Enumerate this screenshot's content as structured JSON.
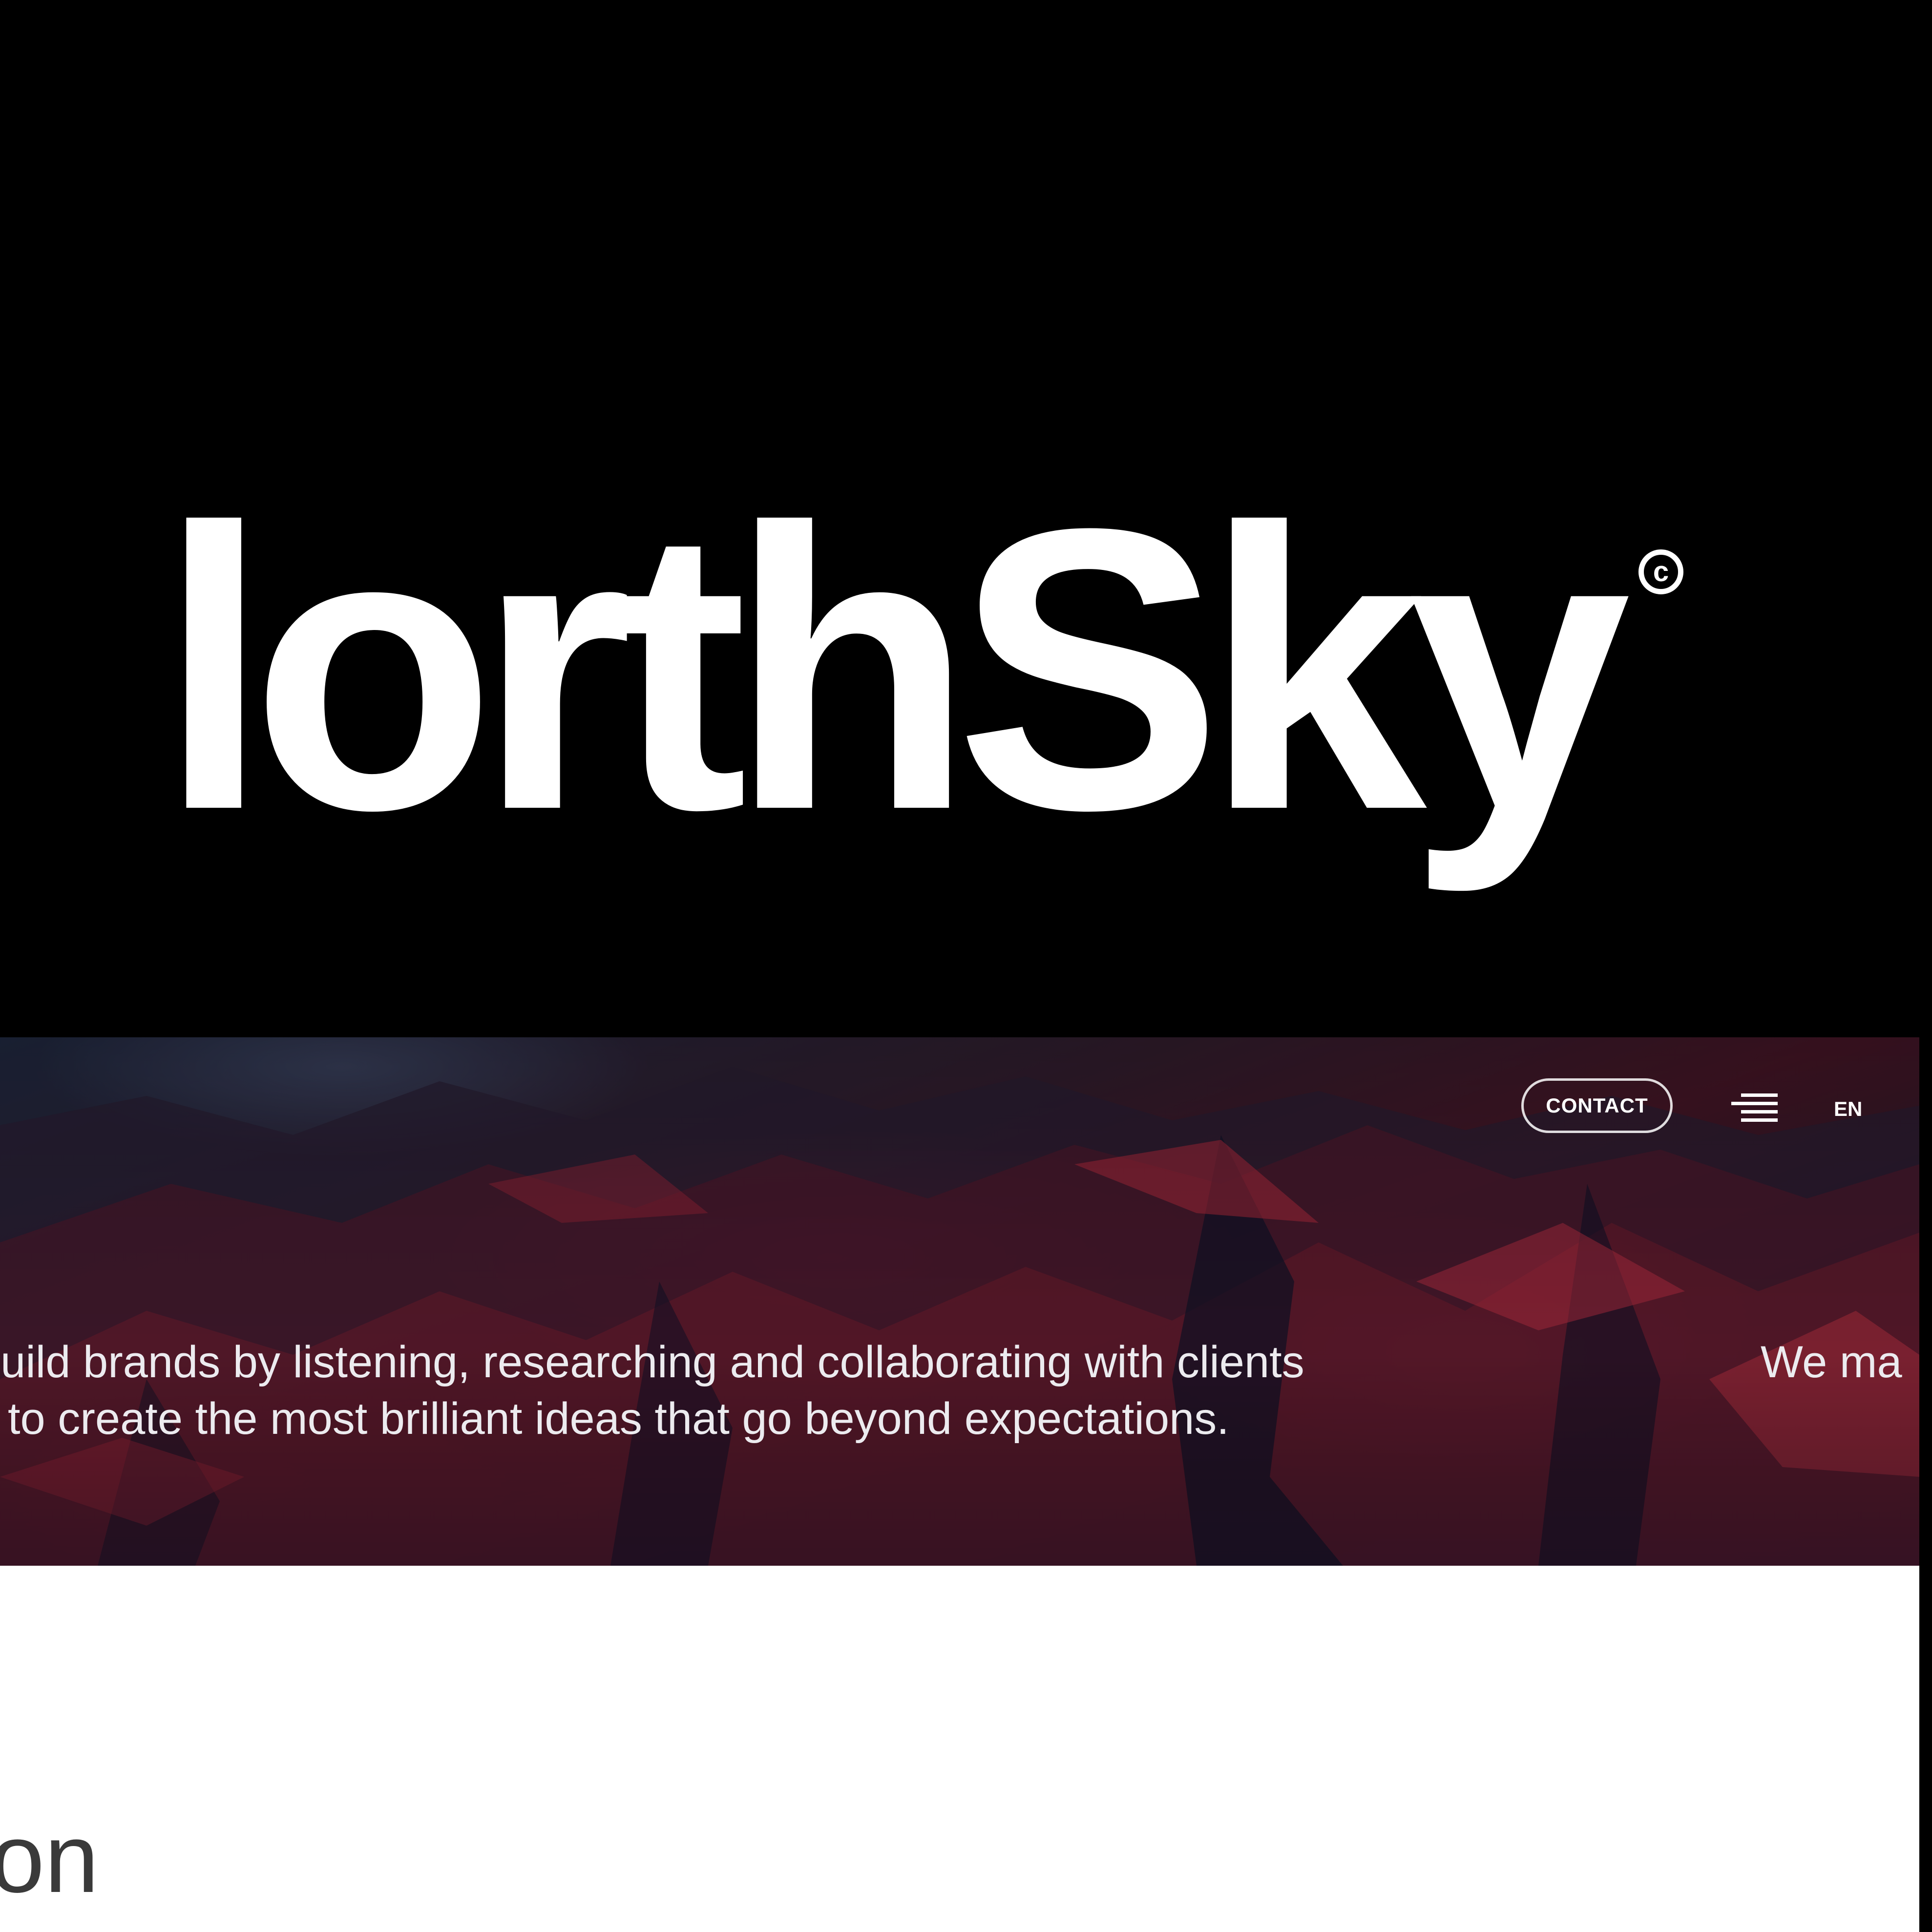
{
  "brand": {
    "wordmark": "lorthSky",
    "copyright_symbol": "c"
  },
  "nav": {
    "contact_label": "CONTACT",
    "menu_icon": "menu-icon",
    "language_label": "EN"
  },
  "hero": {
    "tagline_line1": "build brands by listening, researching and collaborating with clients",
    "tagline_line2": "to create the most brilliant ideas that go beyond expectations.",
    "tagline_right": "We ma"
  },
  "lower": {
    "heading_fragment": "on"
  },
  "colors": {
    "background_band": "#000000",
    "text_on_dark": "#ffffff",
    "hero_accent": "#8a1a2a",
    "lower_background": "#ffffff",
    "lower_text": "#3a3a3a"
  }
}
